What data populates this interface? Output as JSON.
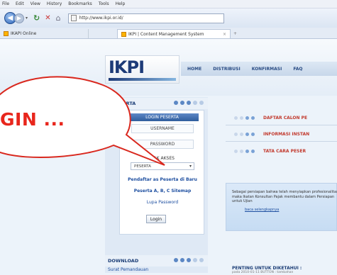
{
  "browser": {
    "menu": [
      "File",
      "Edit",
      "View",
      "History",
      "Bookmarks",
      "Tools",
      "Help"
    ],
    "address": "http://www.ikpi.or.id/",
    "tabs": [
      {
        "label": "IKAPI Online"
      },
      {
        "label": "IKPI | Content Management System"
      }
    ],
    "new_tab": "+",
    "back": "◀",
    "forward": "▶",
    "refresh": "↻",
    "stop": "✕",
    "home": "⌂",
    "dropdown": "▾",
    "tab_close": "×"
  },
  "site": {
    "logo": "IKPI",
    "nav": [
      "HOME",
      "DISTRIBUSI",
      "KONFIRMASI",
      "FAQ"
    ]
  },
  "login_panel": {
    "section_title": "A PESERTA",
    "header": "LOGIN PESERTA",
    "username": "USERNAME",
    "password": "PASSWORD",
    "access_label": "HAK AKSES",
    "access_value": "PESERTA",
    "register_link": "Pendaftar as Peserta di Baru",
    "forgot_link": "Peserta A, B, C Sitemap",
    "lost_password": "Lupa Password",
    "login_button": "Login"
  },
  "download": {
    "section_title": "DOWNLOAD",
    "first_item": "Surat Pemandauan"
  },
  "right_links": [
    {
      "label": "DAFTAR CALON PE"
    },
    {
      "label": "INFORMASI INSTAN"
    },
    {
      "label": "TATA CARA PESER"
    }
  ],
  "info": {
    "text": "Sebagai persiapan bahwa telah menyiapkan profesionalitas maka Ikatan Konsultan Pajak membantu dalam Persiapan untuk Ujian",
    "more": "baca selengkapnya"
  },
  "pentitle": "PENTING UNTUK DIKETAHUI :",
  "pensub": "pada 2010-01-11 BUTTON : tambahan",
  "callout": "GIN ...",
  "colors": {
    "accent": "#1d3b78",
    "callout": "#e8261c"
  }
}
